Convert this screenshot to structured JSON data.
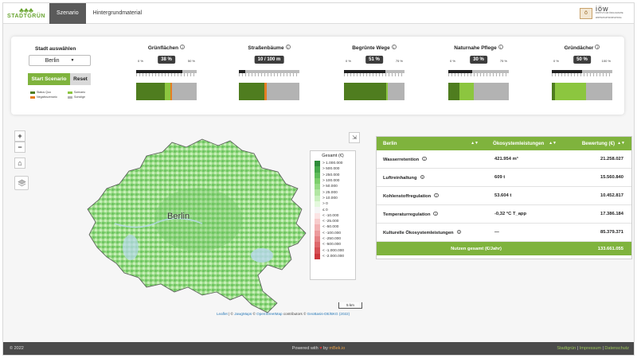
{
  "nav": {
    "logo_text": "STADTGRÜN",
    "tabs": [
      {
        "label": "Szenario",
        "active": true
      },
      {
        "label": "Hintergrundmaterial",
        "active": false
      }
    ],
    "partner_logo": {
      "mark": "ö",
      "name": "iöw",
      "subtitle": "INSTITUT FÜR ÖKOLOGISCHE WIRTSCHAFTSFORSCHUNG"
    }
  },
  "scenario": {
    "city_label": "Stadt auswählen",
    "city_value": "Berlin",
    "start_button": "Start Scenario",
    "reset_button": "Reset",
    "legend": [
      {
        "label": "Status Quo",
        "color": "#4f7d1f"
      },
      {
        "label": "Szenario",
        "color": "#8cc63f"
      },
      {
        "label": "Negativszenario",
        "color": "#e67e22"
      },
      {
        "label": "Sonstige",
        "color": "#b3b3b3"
      }
    ],
    "sliders": [
      {
        "title": "Grünflächen",
        "min": "0 %",
        "max": "50 %",
        "value": "38 %",
        "fraction": 0.76,
        "bar": [
          {
            "c": "#4f7d1f",
            "f": 0.48
          },
          {
            "c": "#8cc63f",
            "f": 0.08
          },
          {
            "c": "#e67e22",
            "f": 0.03
          },
          {
            "c": "#b3b3b3",
            "f": 0.41
          }
        ]
      },
      {
        "title": "Straßenbäume",
        "min": "",
        "max": "",
        "value": "10 / 100 m",
        "fraction": 0.1,
        "bar": [
          {
            "c": "#4f7d1f",
            "f": 0.42
          },
          {
            "c": "#e67e22",
            "f": 0.04
          },
          {
            "c": "#b3b3b3",
            "f": 0.54
          }
        ]
      },
      {
        "title": "Begrünte Wege",
        "min": "0 %",
        "max": "75 %",
        "value": "51 %",
        "fraction": 0.68,
        "bar": [
          {
            "c": "#4f7d1f",
            "f": 0.7
          },
          {
            "c": "#8cc63f",
            "f": 0.02
          },
          {
            "c": "#b3b3b3",
            "f": 0.28
          }
        ]
      },
      {
        "title": "Naturnahe Pflege",
        "min": "0 %",
        "max": "75 %",
        "value": "30 %",
        "fraction": 0.4,
        "bar": [
          {
            "c": "#4f7d1f",
            "f": 0.18
          },
          {
            "c": "#8cc63f",
            "f": 0.24
          },
          {
            "c": "#b3b3b3",
            "f": 0.58
          }
        ]
      },
      {
        "title": "Gründächer",
        "min": "0 %",
        "max": "100 %",
        "value": "50 %",
        "fraction": 0.5,
        "bar": [
          {
            "c": "#4f7d1f",
            "f": 0.05
          },
          {
            "c": "#8cc63f",
            "f": 0.52
          },
          {
            "c": "#b3b3b3",
            "f": 0.43
          }
        ]
      }
    ]
  },
  "map": {
    "city_label": "Berlin",
    "legend_title": "Gesamt (€)",
    "legend": [
      {
        "label": "> 1.000.000",
        "color": "#2e8b3a"
      },
      {
        "label": "> 500.000",
        "color": "#45a84a"
      },
      {
        "label": "> 250.000",
        "color": "#5fbd5a"
      },
      {
        "label": "> 100.000",
        "color": "#7dcf6c"
      },
      {
        "label": "> 50.000",
        "color": "#97db86"
      },
      {
        "label": "> 25.000",
        "color": "#b2e6a3"
      },
      {
        "label": "> 10.000",
        "color": "#caf0bf"
      },
      {
        "label": "> 0",
        "color": "#e4f8dd"
      },
      {
        "label": "≤ 0",
        "color": "#f5f5f5"
      },
      {
        "label": "< -10.000",
        "color": "#fbe4e4"
      },
      {
        "label": "< -25.000",
        "color": "#f7cccc"
      },
      {
        "label": "< -50.000",
        "color": "#f2b3b4"
      },
      {
        "label": "< -100.000",
        "color": "#ec9a9c"
      },
      {
        "label": "< -250.000",
        "color": "#e58184"
      },
      {
        "label": "< -500.000",
        "color": "#de686c"
      },
      {
        "label": "< -1.000.000",
        "color": "#d64f55"
      },
      {
        "label": "< -2.000.000",
        "color": "#cc373d"
      }
    ],
    "scale_label": "5 km",
    "attribution": {
      "leaflet": "Leaflet",
      "sep1": " | © ",
      "jawg": "JawgMaps",
      "sep2": " © ",
      "osm": "OpenStreetMap",
      "sep3": " contributors © ",
      "geobasis": "GeoBasis-DE/BKG (2022)"
    },
    "controls": {
      "zoom_in": "+",
      "zoom_out": "−",
      "home": "⌂"
    }
  },
  "table": {
    "headers": [
      "Berlin",
      "Ökosystemleistungen",
      "Bewertung (€)"
    ],
    "rows": [
      {
        "name": "Wasserretention",
        "amount": "421.954 m³",
        "value": "21.258.027"
      },
      {
        "name": "Luftreinhaltung",
        "amount": "609 t",
        "value": "15.560.840"
      },
      {
        "name": "Kohlenstoffregulation",
        "amount": "53.604 t",
        "value": "10.452.817"
      },
      {
        "name": "Temperaturregulation",
        "amount": "-0,32 °C T_app",
        "value": "17.386.184"
      },
      {
        "name": "Kulturelle Ökosystemleistungen",
        "amount": "—",
        "value": "85.379.371"
      }
    ],
    "total_label": "Nutzen gesamt (€/Jahr)",
    "total_value": "133.661.055"
  },
  "footer": {
    "copyright": "© 2022",
    "powered_prefix": "Powered with ",
    "powered_by": " by ",
    "powered_brand": "mBek.io",
    "links": [
      "Stadtgrün",
      "Impressum",
      "Datenschutz"
    ]
  }
}
